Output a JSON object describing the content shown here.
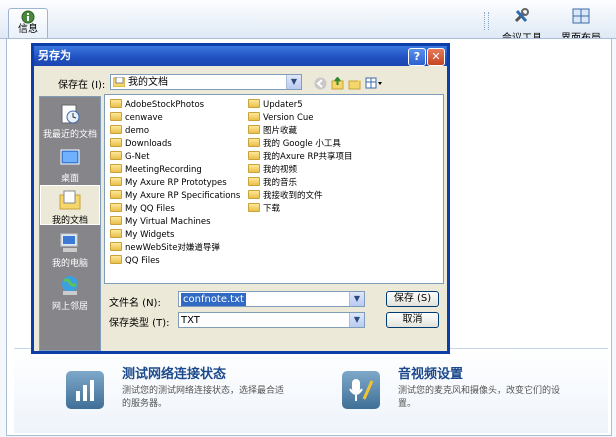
{
  "toolbar": {
    "info_tab": "信息",
    "meeting_tools": "会议工具",
    "layout": "界面布局"
  },
  "dialog": {
    "title": "另存为",
    "save_in_label": "保存在 (I):",
    "location": "我的文档",
    "places": [
      "我最近的文档",
      "桌面",
      "我的文档",
      "我的电脑",
      "网上邻居"
    ],
    "files_left": [
      {
        "name": "AdobeStockPhotos",
        "icon": "folder-icon"
      },
      {
        "name": "cenwave",
        "icon": "folder-icon"
      },
      {
        "name": "demo",
        "icon": "folder-icon"
      },
      {
        "name": "Downloads",
        "icon": "folder-icon"
      },
      {
        "name": "G-Net",
        "icon": "folder-icon"
      },
      {
        "name": "MeetingRecording",
        "icon": "folder-icon"
      },
      {
        "name": "My Axure RP Prototypes",
        "icon": "folder-icon"
      },
      {
        "name": "My Axure RP Specifications",
        "icon": "folder-icon"
      },
      {
        "name": "My QQ Files",
        "icon": "folder-icon"
      },
      {
        "name": "My Virtual Machines",
        "icon": "folder-icon"
      },
      {
        "name": "My Widgets",
        "icon": "folder-icon"
      },
      {
        "name": "newWebSite对嫌道导弹",
        "icon": "folder-icon"
      },
      {
        "name": "QQ Files",
        "icon": "folder-icon"
      }
    ],
    "files_right": [
      {
        "name": "Updater5",
        "icon": "folder-icon"
      },
      {
        "name": "Version Cue",
        "icon": "folder-icon"
      },
      {
        "name": "图片收藏",
        "icon": "pictures-folder-icon"
      },
      {
        "name": "我的 Google 小工具",
        "icon": "folder-icon"
      },
      {
        "name": "我的Axure RP共享项目",
        "icon": "folder-icon"
      },
      {
        "name": "我的视频",
        "icon": "folder-icon"
      },
      {
        "name": "我的音乐",
        "icon": "music-folder-icon"
      },
      {
        "name": "我接收到的文件",
        "icon": "folder-icon"
      },
      {
        "name": "下载",
        "icon": "folder-icon"
      }
    ],
    "filename_label": "文件名 (N):",
    "filename_value": "confnote.txt",
    "filetype_label": "保存类型 (T):",
    "filetype_value": "TXT",
    "save_button": "保存 (S)",
    "cancel_button": "取消"
  },
  "cards": [
    {
      "title": "测试网络连接状态",
      "desc": "测试您的测试网络连接状态，选择最合适的服务器。"
    },
    {
      "title": "音视频设置",
      "desc": "测试您的麦克风和摄像头，改变它们的设置。"
    }
  ]
}
